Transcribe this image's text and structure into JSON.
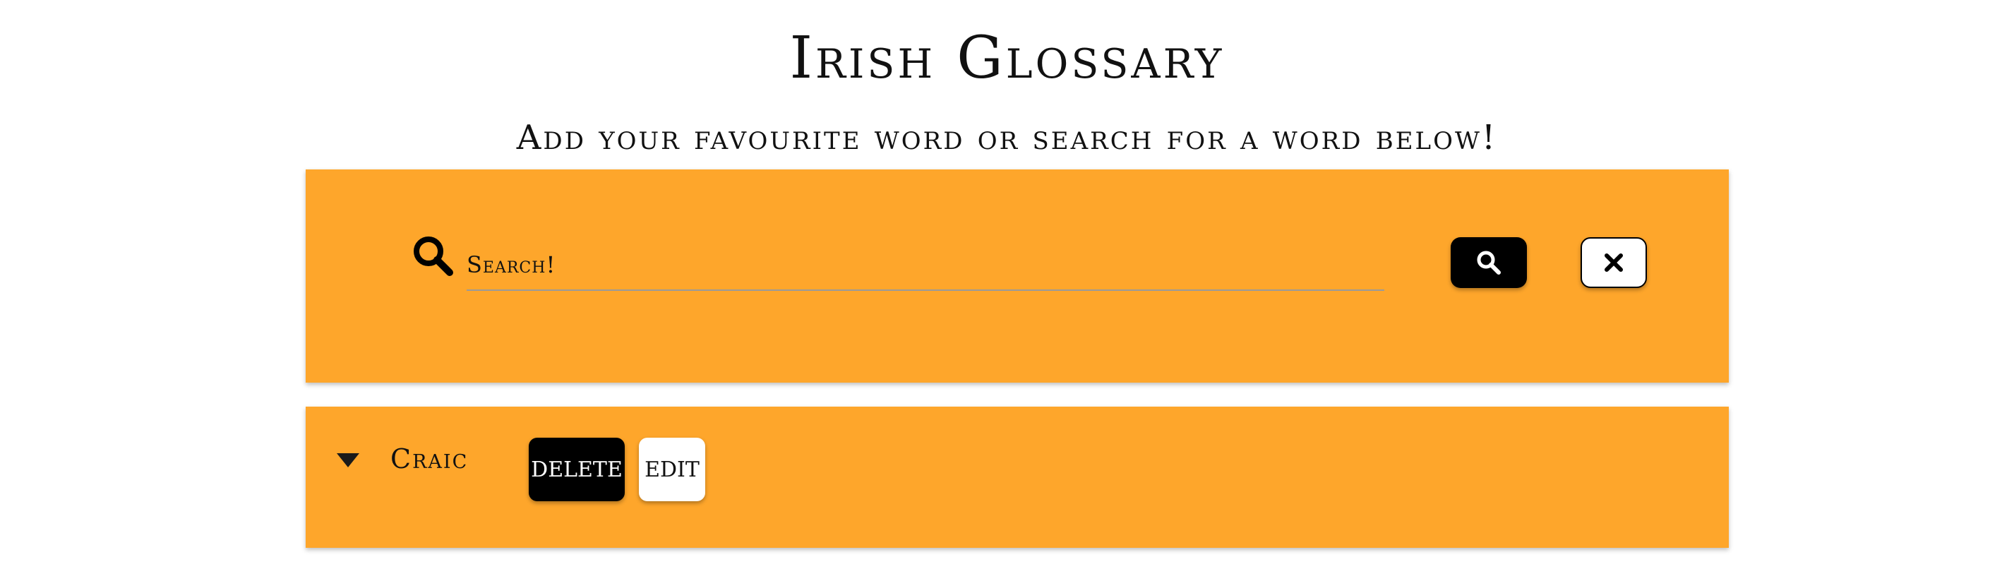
{
  "header": {
    "title": "Irish Glossary",
    "subtitle": "Add your favourite word or search for a word below!"
  },
  "search": {
    "placeholder": "Search!",
    "value": "",
    "search_button_icon": "search-icon",
    "clear_button_icon": "close-icon"
  },
  "words": [
    {
      "term": "Craic",
      "expand_icon": "caret-down-icon",
      "delete_label": "DELETE",
      "edit_label": "EDIT"
    }
  ],
  "colors": {
    "accent": "#fea62b",
    "primary_button": "#000000",
    "secondary_button": "#ffffff"
  }
}
